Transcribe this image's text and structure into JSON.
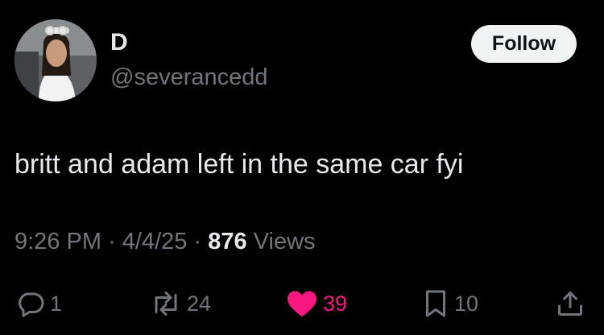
{
  "author": {
    "display_name": "D",
    "handle": "@severancedd"
  },
  "follow_button": {
    "label": "Follow"
  },
  "tweet": {
    "text": "britt and adam left in the same car fyi"
  },
  "meta": {
    "time": "9:26 PM",
    "sep1": "·",
    "date": "4/4/25",
    "sep2": "·",
    "views_count": "876",
    "views_label": "Views"
  },
  "actions": {
    "replies": "1",
    "reposts": "24",
    "likes": "39",
    "bookmarks": "10"
  },
  "colors": {
    "like": "#f91880",
    "muted": "#71767b",
    "text": "#e7e9ea"
  },
  "icons": [
    "reply-icon",
    "repost-icon",
    "heart-icon",
    "bookmark-icon",
    "share-icon"
  ]
}
